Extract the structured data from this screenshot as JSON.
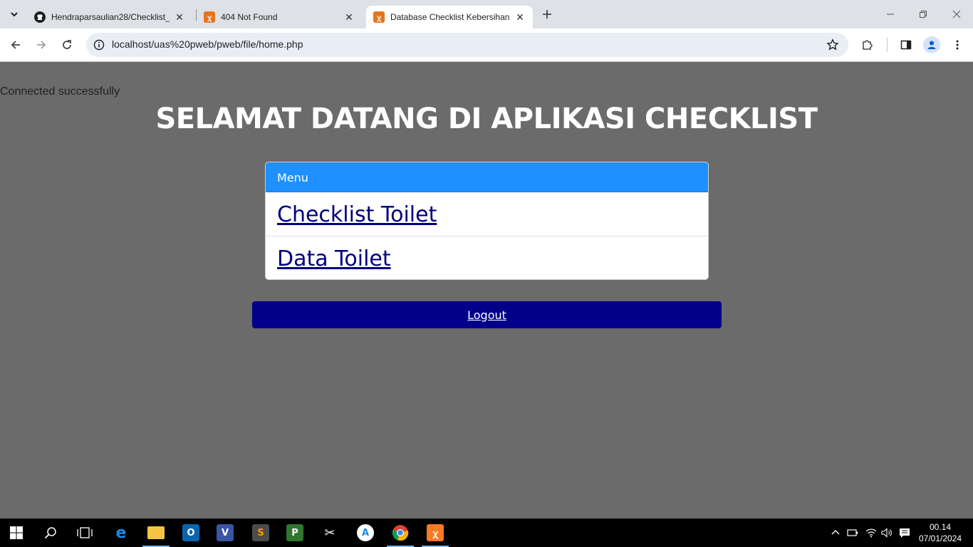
{
  "browser": {
    "tabs": [
      {
        "title": "Hendraparsaulian28/Checklist_",
        "favicon": "github-icon",
        "active": false
      },
      {
        "title": "404 Not Found",
        "favicon": "xampp-icon",
        "active": false
      },
      {
        "title": "Database Checklist Kebersihan",
        "favicon": "xampp-icon",
        "active": true
      }
    ],
    "url": "localhost/uas%20pweb/pweb/file/home.php"
  },
  "page": {
    "status_text": "Connected successfully",
    "heading": "SELAMAT DATANG DI APLIKASI CHECKLIST",
    "menu": {
      "header": "Menu",
      "items": [
        "Checklist Toilet",
        "Data Toilet"
      ]
    },
    "logout_label": "Logout"
  },
  "taskbar": {
    "time": "00.14",
    "date": "07/01/2024",
    "apps": [
      "start",
      "search",
      "task-view",
      "edge",
      "file-explorer",
      "outlook",
      "visio",
      "sublime-text",
      "project",
      "snipping-tool",
      "app-store",
      "chrome",
      "xampp"
    ]
  },
  "colors": {
    "page_bg": "#6b6b6b",
    "menu_header": "#1e90ff",
    "link": "#000080",
    "logout_bg": "#00008b"
  }
}
